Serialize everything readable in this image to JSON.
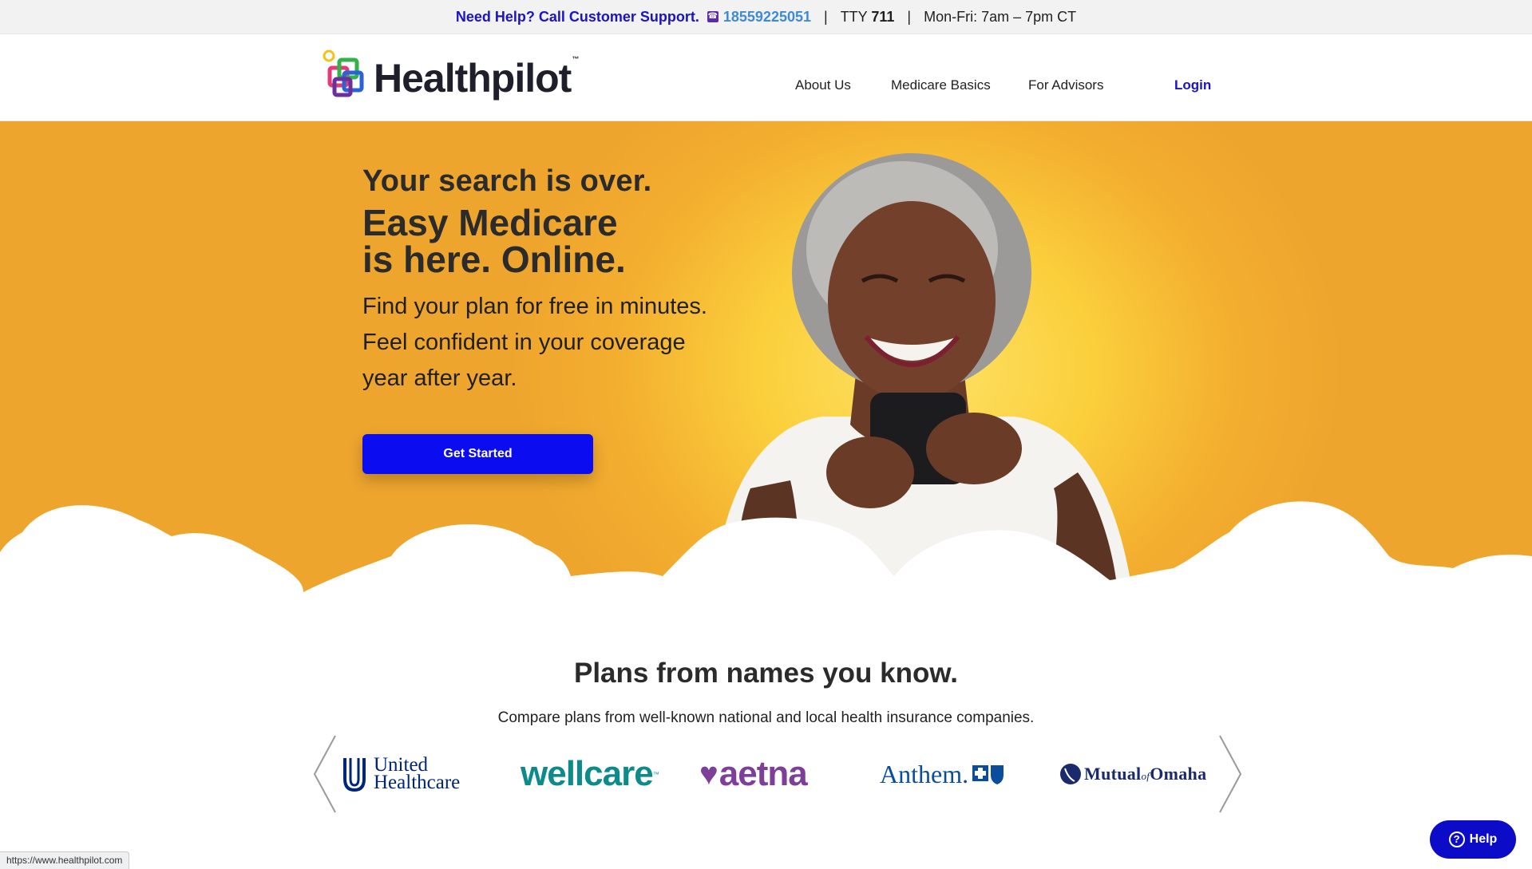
{
  "topbar": {
    "help_text": "Need Help? Call Customer Support.",
    "phone_icon": "phone-icon",
    "phone": "18559225051",
    "tty_label": "TTY",
    "tty_number": "711",
    "hours": "Mon-Fri: 7am – 7pm CT"
  },
  "header": {
    "logo_text": "Healthpilot",
    "logo_tm": "™",
    "nav": {
      "about": "About Us",
      "basics": "Medicare Basics",
      "advisors": "For Advisors",
      "login": "Login"
    }
  },
  "hero": {
    "eyebrow": "Your search is over.",
    "headline_1": "Easy Medicare",
    "headline_2": "is here. Online.",
    "body": "Find your plan for free in minutes. Feel confident in your coverage year after year.",
    "cta": "Get Started",
    "image": "smiling-woman-with-phone"
  },
  "plans": {
    "title": "Plans from names you know.",
    "subtitle": "Compare plans from well-known national and local health insurance companies.",
    "brands": {
      "uh_line1": "United",
      "uh_line2": "Healthcare",
      "wellcare": "wellcare",
      "wellcare_tm": "™",
      "aetna": "aetna",
      "anthem": "Anthem.",
      "omaha_1": "Mutual",
      "omaha_of": "of",
      "omaha_2": "Omaha"
    }
  },
  "status_url": "https://www.healthpilot.com",
  "help_button": "Help",
  "colors": {
    "brand_blue": "#0c0cf0",
    "hero_orange": "#eea52e",
    "hero_yellow": "#fde267"
  }
}
